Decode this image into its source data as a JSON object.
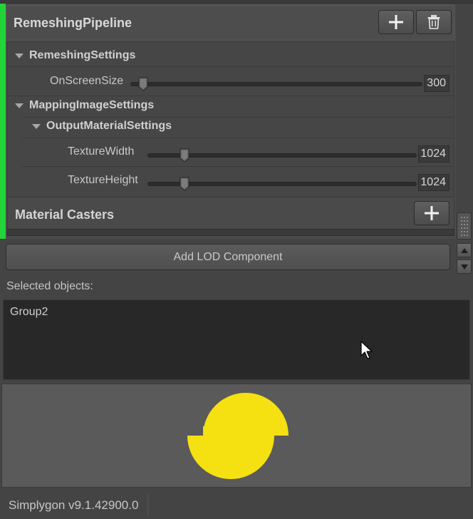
{
  "pipeline": {
    "title": "RemeshingPipeline",
    "status_color": "#22d43a",
    "add_icon": "plus-icon",
    "delete_icon": "trash-icon"
  },
  "remeshing_settings": {
    "title": "RemeshingSettings",
    "onscreen_size": {
      "label": "OnScreenSize",
      "value": "300",
      "fraction": 0.03
    }
  },
  "mapping_image_settings": {
    "title": "MappingImageSettings",
    "output_material_settings": {
      "title": "OutputMaterialSettings",
      "texture_width": {
        "label": "TextureWidth",
        "value": "1024",
        "fraction": 0.14
      },
      "texture_height": {
        "label": "TextureHeight",
        "value": "1024",
        "fraction": 0.14
      }
    }
  },
  "material_casters": {
    "title": "Material Casters",
    "add_icon": "plus-icon"
  },
  "add_lod_button": "Add LOD Component",
  "selected_objects": {
    "label": "Selected objects:",
    "items": [
      "Group2"
    ]
  },
  "logo": {
    "icon": "simplygon-logo",
    "color": "#f5e012"
  },
  "status": {
    "version": "Simplygon v9.1.42900.0"
  }
}
